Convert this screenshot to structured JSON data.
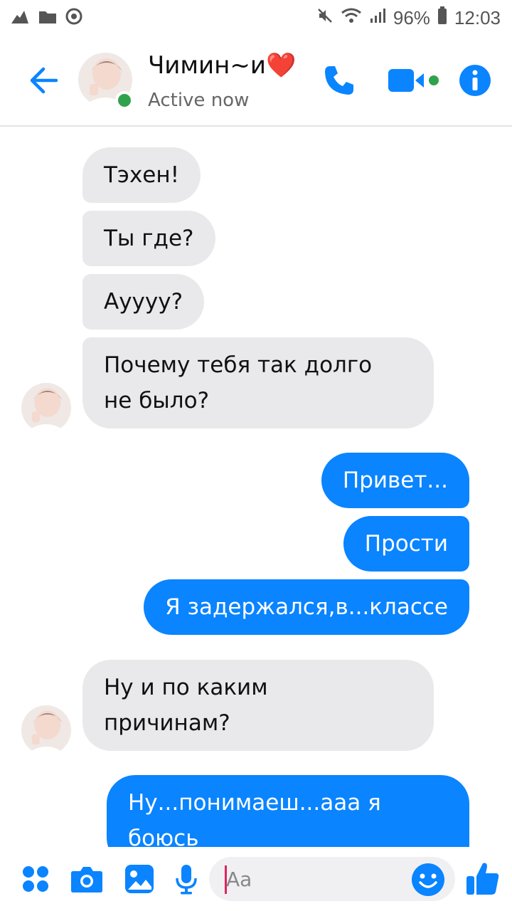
{
  "status_bar": {
    "battery": "96%",
    "time": "12:03"
  },
  "header": {
    "contact_name": "Чимин~и❤️",
    "contact_status": "Active now",
    "icons": {
      "back": "back-arrow-icon",
      "call": "phone-icon",
      "video": "video-camera-icon",
      "info": "info-icon"
    }
  },
  "messages": [
    {
      "dir": "in",
      "text": "Тэхен!"
    },
    {
      "dir": "in",
      "text": "Ты где?"
    },
    {
      "dir": "in",
      "text": "Ауууу?"
    },
    {
      "dir": "in",
      "lines": [
        "Почему тебя так долго",
        "не было?"
      ]
    },
    {
      "dir": "out",
      "text": "Привет..."
    },
    {
      "dir": "out",
      "text": "Прости"
    },
    {
      "dir": "out",
      "text": "Я задержался,в...классе"
    },
    {
      "dir": "in",
      "lines": [
        "Ну и по каким",
        "причинам?"
      ]
    },
    {
      "dir": "out",
      "lines": [
        "Ну...понимаеш...ааа я",
        "боюсь"
      ]
    }
  ],
  "composer": {
    "placeholder": "Aa",
    "icons": [
      "apps-icon",
      "camera-icon",
      "gallery-icon",
      "microphone-icon",
      "emoji-icon",
      "thumbs-up-icon"
    ]
  },
  "colors": {
    "accent": "#0a84ff",
    "incoming_bubble": "#e9e9eb",
    "online": "#31a24c"
  }
}
